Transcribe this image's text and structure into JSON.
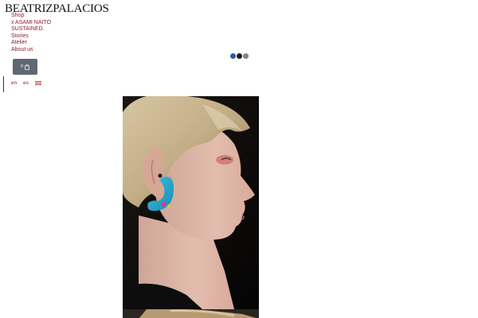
{
  "brand": {
    "logo_text": "BEATRIZPALACIOS"
  },
  "nav": {
    "items": [
      {
        "label": "Shop"
      },
      {
        "label": "x ASAMI NAITO"
      },
      {
        "label": "SUSTAINED."
      },
      {
        "label": "Stories"
      },
      {
        "label": "Atelier"
      },
      {
        "label": "About us"
      }
    ]
  },
  "cart": {
    "count": "0",
    "icon": "shopping-bag-icon"
  },
  "loader": {
    "dot_colors": [
      "#2d5aa0",
      "#1c1c1c",
      "#7d8290"
    ]
  },
  "language": {
    "options": [
      "en",
      "es"
    ],
    "flag_icon": "uk-flag-icon"
  },
  "colors": {
    "nav_link": "#8a1c2b",
    "cart_bg": "#5f6772"
  }
}
